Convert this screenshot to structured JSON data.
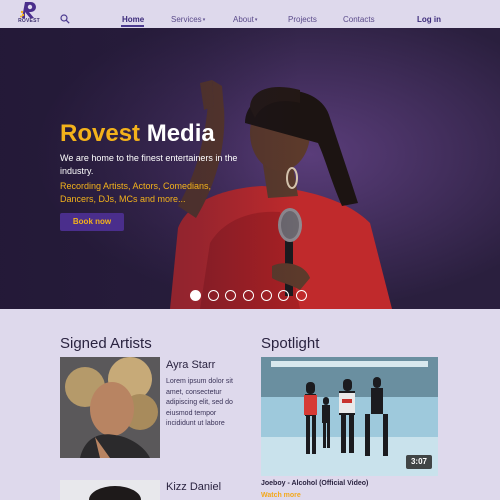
{
  "brand": {
    "logo_text": "ROVEST"
  },
  "nav": {
    "items": [
      {
        "label": "Home",
        "active": true
      },
      {
        "label": "Services",
        "dropdown": true
      },
      {
        "label": "About",
        "dropdown": true
      },
      {
        "label": "Projects"
      },
      {
        "label": "Contacts"
      }
    ],
    "login_label": "Log in"
  },
  "hero": {
    "title_part1": "Rovest",
    "title_part2": "Media",
    "subtitle": "We are home to the finest entertainers in the industry.",
    "list": "Recording Artists, Actors, Comedians, Dancers, DJs, MCs and more...",
    "cta_label": "Book now",
    "slide_count": 7,
    "active_slide": 1
  },
  "signed_artists": {
    "title": "Signed Artists",
    "artists": [
      {
        "name": "Ayra Starr",
        "description": "Lorem ipsum dolor sit amet, consectetur adipiscing elit, sed do eiusmod tempor incididunt ut labore"
      },
      {
        "name": "Kizz Daniel"
      }
    ]
  },
  "spotlight": {
    "title": "Spotlight",
    "duration": "3:07",
    "caption": "Joeboy - Alcohol (Official Video)",
    "link_label": "Watch more"
  },
  "colors": {
    "accent": "#f3b21b",
    "brand_purple": "#4a2e8c",
    "background": "#ded9ec"
  }
}
